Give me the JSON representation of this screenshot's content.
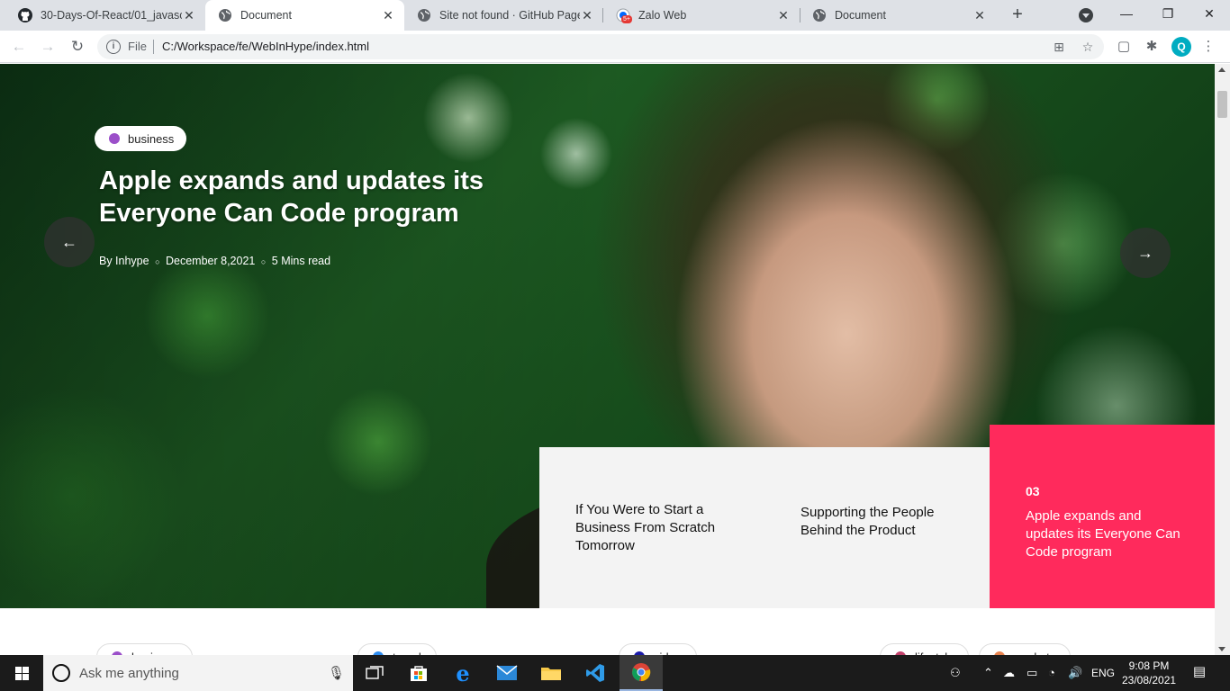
{
  "browser": {
    "tabs": [
      {
        "title": "30-Days-Of-React/01_javascri",
        "favicon": "github-icon",
        "active": false
      },
      {
        "title": "Document",
        "favicon": "globe-icon",
        "active": true
      },
      {
        "title": "Site not found · GitHub Pages",
        "favicon": "globe-icon",
        "active": false
      },
      {
        "title": "Zalo Web",
        "favicon": "zalo-icon",
        "active": false
      },
      {
        "title": "Document",
        "favicon": "globe-icon",
        "active": false
      }
    ],
    "zalo_badge": "5+",
    "new_tab": "+",
    "window_controls": {
      "minimize": "—",
      "maximize": "❐",
      "close": "✕"
    },
    "address": {
      "scheme_label": "File",
      "url": "C:/Workspace/fe/WebInHype/index.html"
    },
    "profile_initial": "Q"
  },
  "hero": {
    "category": {
      "label": "business",
      "color": "#9b4fc9"
    },
    "title": "Apple expands and updates its Everyone Can Code program",
    "author": "By Inhype",
    "date": "December 8,2021",
    "read_time": "5 Mins read",
    "meta_separator": "○",
    "prev_arrow": "←",
    "next_arrow": "→"
  },
  "featured_posts": [
    {
      "title": "If You Were to Start a Business From Scratch Tomorrow"
    },
    {
      "title": "Supporting the People Behind the Product"
    },
    {
      "number": "03",
      "title": "Apple expands and updates its Everyone Can Code program",
      "color": "#ff2a5c"
    }
  ],
  "categories": [
    {
      "label": "business",
      "color": "#9b4fc9"
    },
    {
      "label": "travel",
      "color": "#2d8cf0"
    },
    {
      "label": "video",
      "color": "#1a1aa8"
    },
    {
      "label": "lifestyle",
      "color": "#c2416b"
    },
    {
      "label": "markets",
      "color": "#e8834e"
    }
  ],
  "taskbar": {
    "search_placeholder": "Ask me anything",
    "language": "ENG",
    "time": "9:08 PM",
    "date": "23/08/2021",
    "apps": [
      "task-view-icon",
      "store-icon",
      "edge-icon",
      "mail-icon",
      "file-explorer-icon",
      "vscode-icon",
      "chrome-icon"
    ]
  }
}
